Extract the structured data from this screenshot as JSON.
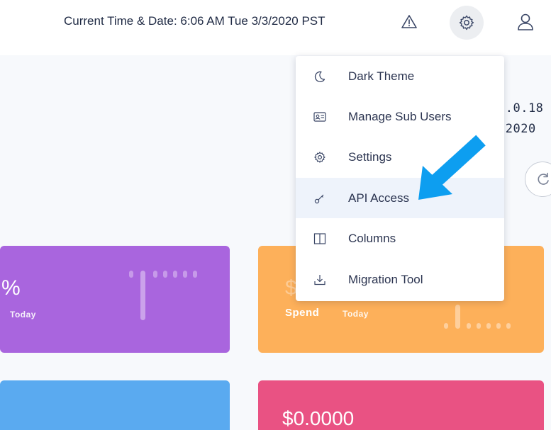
{
  "header": {
    "datetime": "Current Time & Date: 6:06 AM Tue 3/3/2020 PST",
    "icons": [
      "warning-icon",
      "gear-icon",
      "user-icon"
    ]
  },
  "background": {
    "version_line1": "2.0.18",
    "version_line2": "/2020"
  },
  "cards": {
    "purple": {
      "value": "%",
      "sub": "Today",
      "color": "#a965de"
    },
    "orange": {
      "value": "$",
      "label": "Spend",
      "sub": "Today",
      "color": "#fdb05a"
    },
    "blue": {
      "color": "#5aaaf0"
    },
    "red": {
      "value": "$0.0000",
      "color": "#e95283"
    }
  },
  "menu": {
    "items": [
      {
        "label": "Dark Theme",
        "icon": "moon-icon"
      },
      {
        "label": "Manage Sub Users",
        "icon": "id-card-icon"
      },
      {
        "label": "Settings",
        "icon": "gear-icon"
      },
      {
        "label": "API Access",
        "icon": "key-icon",
        "highlighted": true
      },
      {
        "label": "Columns",
        "icon": "columns-icon"
      },
      {
        "label": "Migration Tool",
        "icon": "download-icon"
      }
    ]
  },
  "colors": {
    "accent_arrow": "#0d9ef0",
    "menu_highlight": "#eef3fb",
    "text": "#2b3450"
  }
}
